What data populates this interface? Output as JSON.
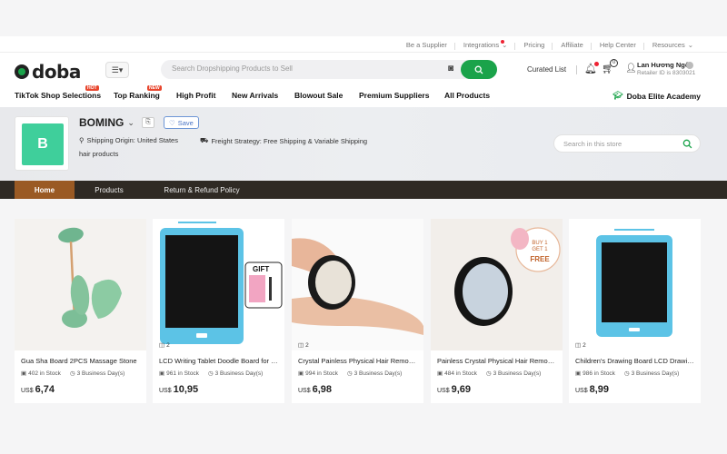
{
  "topbar": {
    "links": [
      "Be a Supplier",
      "Integrations",
      "Pricing",
      "Affiliate",
      "Help Center",
      "Resources"
    ]
  },
  "header": {
    "logo_text": "doba",
    "search_placeholder": "Search Dropshipping Products to Sell",
    "curated_list": "Curated List",
    "cart_count": "0",
    "user_name": "Lan Hương Ngô",
    "user_id": "Retailer ID is 8303021"
  },
  "nav": {
    "items": [
      {
        "label": "TikTok Shop Selections",
        "badge": "HOT"
      },
      {
        "label": "Top Ranking",
        "badge": "NEW"
      },
      {
        "label": "High Profit",
        "badge": ""
      },
      {
        "label": "New Arrivals",
        "badge": ""
      },
      {
        "label": "Blowout Sale",
        "badge": ""
      },
      {
        "label": "Premium Suppliers",
        "badge": ""
      },
      {
        "label": "All Products",
        "badge": ""
      }
    ],
    "academy": "Doba Elite Academy"
  },
  "store": {
    "logo_letter": "B",
    "name": "BOMING",
    "save": "Save",
    "shipping_origin": "Shipping Origin: United States",
    "freight": "Freight Strategy: Free Shipping & Variable Shipping",
    "category": "hair products",
    "search_placeholder": "Search in this store"
  },
  "tabs": [
    "Home",
    "Products",
    "Return & Refund Policy"
  ],
  "products": [
    {
      "title": "Gua Sha Board 2PCS Massage Stone",
      "stock": "402 in Stock",
      "ship": "3 Business Day(s)",
      "currency": "US$",
      "price": "6,74",
      "variants": ""
    },
    {
      "title": "LCD Writing Tablet Doodle Board for Kids",
      "stock": "961 in Stock",
      "ship": "3 Business Day(s)",
      "currency": "US$",
      "price": "10,95",
      "variants": "2"
    },
    {
      "title": "Crystal Painless Physical Hair Remover",
      "stock": "994 in Stock",
      "ship": "3 Business Day(s)",
      "currency": "US$",
      "price": "6,98",
      "variants": "2"
    },
    {
      "title": "Painless Crystal Physical Hair Remover",
      "stock": "484 in Stock",
      "ship": "3 Business Day(s)",
      "currency": "US$",
      "price": "9,69",
      "variants": ""
    },
    {
      "title": "Children's Drawing Board LCD Drawing Tablet",
      "stock": "986 in Stock",
      "ship": "3 Business Day(s)",
      "currency": "US$",
      "price": "8,99",
      "variants": "2"
    }
  ],
  "product_image_text": {
    "gift": "GIFT",
    "promo_line1": "BUY 1",
    "promo_line2": "GET 1",
    "promo_line3": "FREE"
  },
  "colors": {
    "brand_green": "#1aa34a",
    "tab_active": "#9a5a24",
    "tab_bar": "#2f2a24",
    "store_logo": "#3fcf9b"
  }
}
